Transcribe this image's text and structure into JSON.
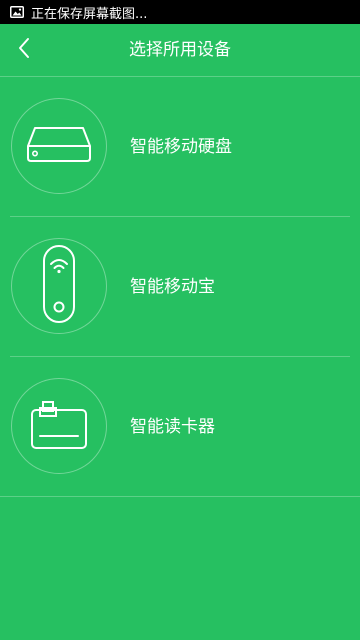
{
  "status_bar": {
    "icon": "image-icon",
    "text": "正在保存屏幕截图..."
  },
  "header": {
    "back_icon": "chevron-left-icon",
    "title": "选择所用设备"
  },
  "devices": [
    {
      "icon": "hard-drive-icon",
      "label": "智能移动硬盘"
    },
    {
      "icon": "wifi-power-bank-icon",
      "label": "智能移动宝"
    },
    {
      "icon": "card-reader-icon",
      "label": "智能读卡器"
    }
  ],
  "colors": {
    "background": "#26c061",
    "status_bar": "#000000",
    "foreground": "#ffffff"
  }
}
